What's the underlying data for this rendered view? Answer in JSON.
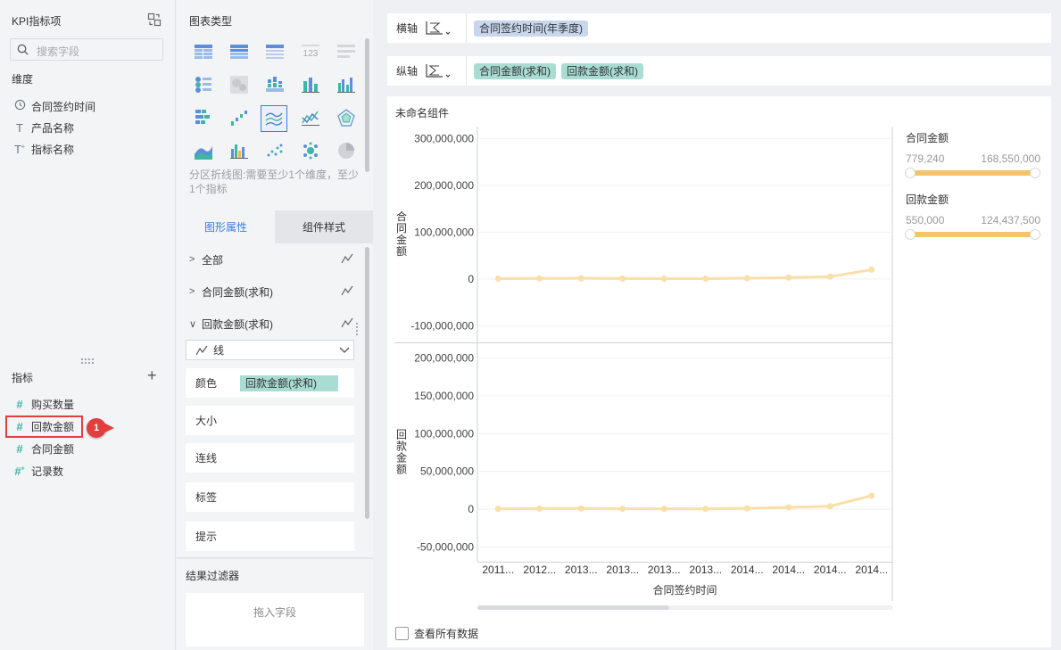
{
  "left_panel": {
    "title": "KPI指标项",
    "search_placeholder": "搜索字段",
    "dimension_label": "维度",
    "dimensions": [
      {
        "icon": "clock-icon",
        "label": "合同签约时间"
      },
      {
        "icon": "text-icon",
        "label": "产品名称"
      },
      {
        "icon": "text-formula-icon",
        "label": "指标名称"
      }
    ],
    "metric_label": "指标",
    "metrics": [
      {
        "icon": "hash-icon",
        "label": "购买数量"
      },
      {
        "icon": "hash-icon",
        "label": "回款金额"
      },
      {
        "icon": "hash-icon",
        "label": "合同金额"
      },
      {
        "icon": "hash-formula-icon",
        "label": "记录数"
      }
    ],
    "badge_number": "1"
  },
  "mid_panel": {
    "chart_types_title": "图表类型",
    "chart_type_note": "分区折线图:需要至少1个维度，至少1个指标",
    "tabs": [
      "图形属性",
      "组件样式"
    ],
    "props": {
      "all": "全部",
      "contract_amount": "合同金额(求和)",
      "payment_amount": "回款金额(求和)"
    },
    "line_select": "线",
    "rows": {
      "color": "颜色",
      "color_field": "回款金额(求和)",
      "size": "大小",
      "connect": "连线",
      "label": "标签",
      "tooltip": "提示"
    },
    "badge_number": "1",
    "result_filter_title": "结果过滤器",
    "drop_field": "拖入字段"
  },
  "x_axis_bar": {
    "label": "横轴",
    "pills": [
      "合同签约时间(年季度)"
    ]
  },
  "y_axis_bar": {
    "label": "纵轴",
    "pills": [
      "合同金额(求和)",
      "回款金额(求和)"
    ]
  },
  "chart_card": {
    "title": "未命名组件",
    "show_all": "查看所有数据"
  },
  "chart_data": {
    "type": "line",
    "xlabel": "合同签约时间",
    "categories": [
      "2011...",
      "2012...",
      "2013...",
      "2013...",
      "2013...",
      "2013...",
      "2014...",
      "2014...",
      "2014...",
      "2014..."
    ],
    "line_color": "#f9dfa8",
    "panels": [
      {
        "ylabel": "合同金额",
        "yticks": [
          "300,000,000",
          "200,000,000",
          "100,000,000",
          "0",
          "-100,000,000"
        ],
        "ytick_values": [
          300000000,
          200000000,
          100000000,
          0,
          -100000000
        ],
        "ylim": [
          -120000000,
          310000000
        ],
        "values": [
          780000,
          1200000,
          1500000,
          1000000,
          800000,
          900000,
          1800000,
          3000000,
          5000000,
          20000000,
          23000000
        ]
      },
      {
        "ylabel": "回款金额",
        "yticks": [
          "200,000,000",
          "150,000,000",
          "100,000,000",
          "50,000,000",
          "0",
          "-50,000,000"
        ],
        "ytick_values": [
          200000000,
          150000000,
          100000000,
          50000000,
          0,
          -50000000
        ],
        "ylim": [
          -60000000,
          210000000
        ],
        "values": [
          550000,
          900000,
          1000000,
          700000,
          600000,
          500000,
          1200000,
          2500000,
          4000000,
          18000000,
          15000000
        ]
      }
    ],
    "legend": [
      {
        "name": "合同金额",
        "min": "779,240",
        "max": "168,550,000"
      },
      {
        "name": "回款金额",
        "min": "550,000",
        "max": "124,437,500"
      }
    ],
    "grid": true
  }
}
